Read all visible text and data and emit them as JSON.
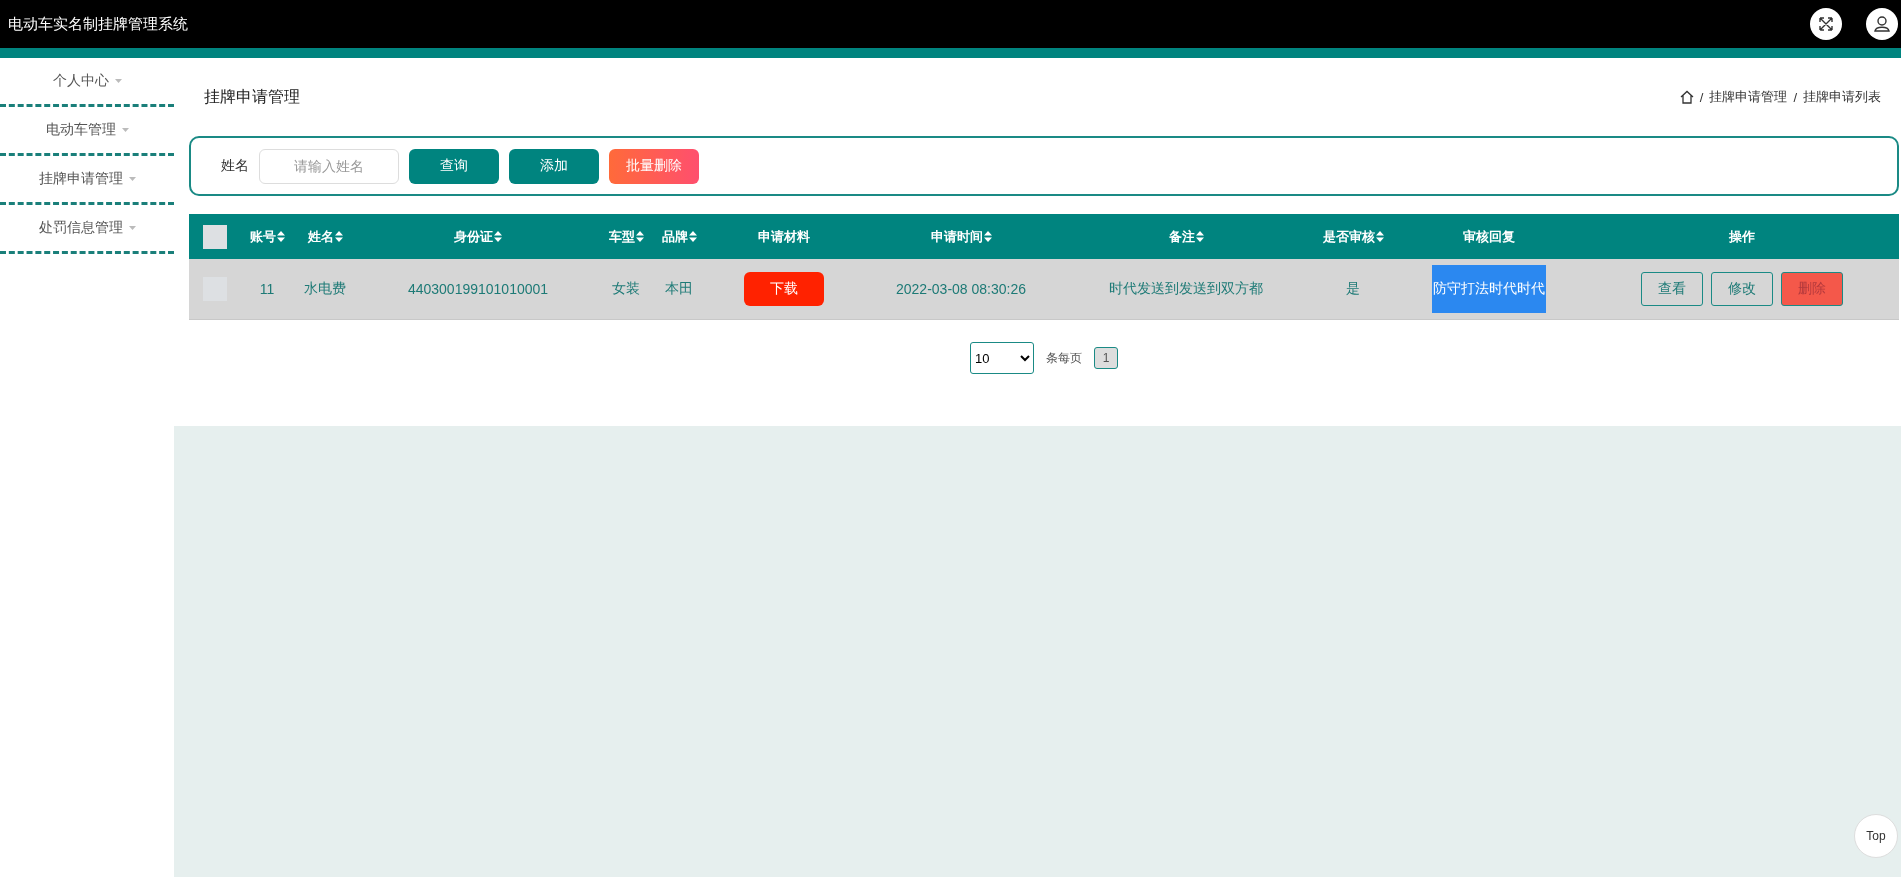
{
  "header": {
    "title": "电动车实名制挂牌管理系统"
  },
  "sidebar": {
    "items": [
      {
        "label": "个人中心"
      },
      {
        "label": "电动车管理"
      },
      {
        "label": "挂牌申请管理"
      },
      {
        "label": "处罚信息管理"
      }
    ]
  },
  "page": {
    "title": "挂牌申请管理",
    "breadcrumb": [
      {
        "kind": "home"
      },
      {
        "kind": "separator",
        "text": "/"
      },
      {
        "kind": "link",
        "text": "挂牌申请管理"
      },
      {
        "kind": "separator",
        "text": "/"
      },
      {
        "kind": "text",
        "text": "挂牌申请列表"
      }
    ]
  },
  "search": {
    "label": "姓名",
    "placeholder": "请输入姓名",
    "buttons": [
      {
        "label": "查询",
        "kind": "primary"
      },
      {
        "label": "添加",
        "kind": "primary"
      },
      {
        "label": "批量删除",
        "kind": "danger"
      }
    ]
  },
  "table": {
    "select_all": {
      "checked": false
    },
    "columns": [
      {
        "label": "账号",
        "sortable": true
      },
      {
        "label": "姓名",
        "sortable": true
      },
      {
        "label": "身份证",
        "sortable": true
      },
      {
        "label": "车型",
        "sortable": true
      },
      {
        "label": "品牌",
        "sortable": true
      },
      {
        "label": "申请材料",
        "sortable": false
      },
      {
        "label": "申请时间",
        "sortable": true
      },
      {
        "label": "备注",
        "sortable": true
      },
      {
        "label": "是否审核",
        "sortable": true
      },
      {
        "label": "审核回复",
        "sortable": false
      },
      {
        "label": "操作",
        "sortable": false
      }
    ],
    "rows": [
      {
        "checked": false,
        "cells": [
          {
            "kind": "text",
            "text": "11"
          },
          {
            "kind": "text",
            "text": "水电费"
          },
          {
            "kind": "text",
            "text": "440300199101010001"
          },
          {
            "kind": "text",
            "text": "女装"
          },
          {
            "kind": "text",
            "text": "本田"
          },
          {
            "kind": "button",
            "text": "下载"
          },
          {
            "kind": "text",
            "text": "2022-03-08 08:30:26"
          },
          {
            "kind": "text",
            "text": "时代发送到发送到双方都"
          },
          {
            "kind": "text",
            "text": "是"
          },
          {
            "kind": "highlight",
            "text": "防守打法时代时代"
          },
          {
            "kind": "actions",
            "actions": [
              {
                "label": "查看",
                "kind": "outline"
              },
              {
                "label": "修改",
                "kind": "outline"
              },
              {
                "label": "删除",
                "kind": "danger"
              }
            ]
          }
        ]
      }
    ]
  },
  "pagination": {
    "page_size": "10",
    "page_size_label": "条每页",
    "pages": [
      {
        "label": "1",
        "selected": true
      }
    ]
  },
  "back_to_top": "Top"
}
